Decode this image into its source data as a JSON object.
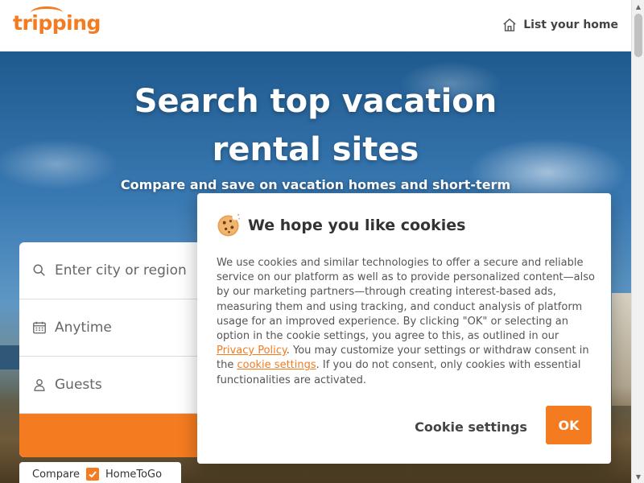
{
  "header": {
    "logo_text": "tripping",
    "list_home_label": "List your home",
    "list_home_icon": "home-icon"
  },
  "hero": {
    "title_line1": "Search top vacation",
    "title_line2": "rental sites",
    "subtitle": "Compare and save on vacation homes and short-term"
  },
  "search": {
    "location_placeholder": "Enter city or region",
    "dates_value": "Anytime",
    "guests_value": "Guests",
    "compare_label": "Compare",
    "compare_partner": "HomeToGo"
  },
  "cookie_modal": {
    "title": "We hope you like cookies",
    "body_part1": "We use cookies and similar technologies to offer a secure and reliable service on our platform as well as to provide personalized content—also by our marketing partners—through creating interest-based ads, measuring them and using tracking, and conduct analysis of platform usage for an improved experience. By clicking \"OK\" or selecting an option in the cookie settings, you agree to this, as outlined in our ",
    "privacy_link": "Privacy Policy",
    "body_part2": ". You may customize your settings or withdraw consent in the ",
    "settings_link": "cookie settings",
    "body_part3": ". If you do not consent, only cookies with essential functionalities are activated.",
    "settings_button": "Cookie settings",
    "ok_button": "OK"
  },
  "colors": {
    "brand_orange": "#f47b20"
  }
}
